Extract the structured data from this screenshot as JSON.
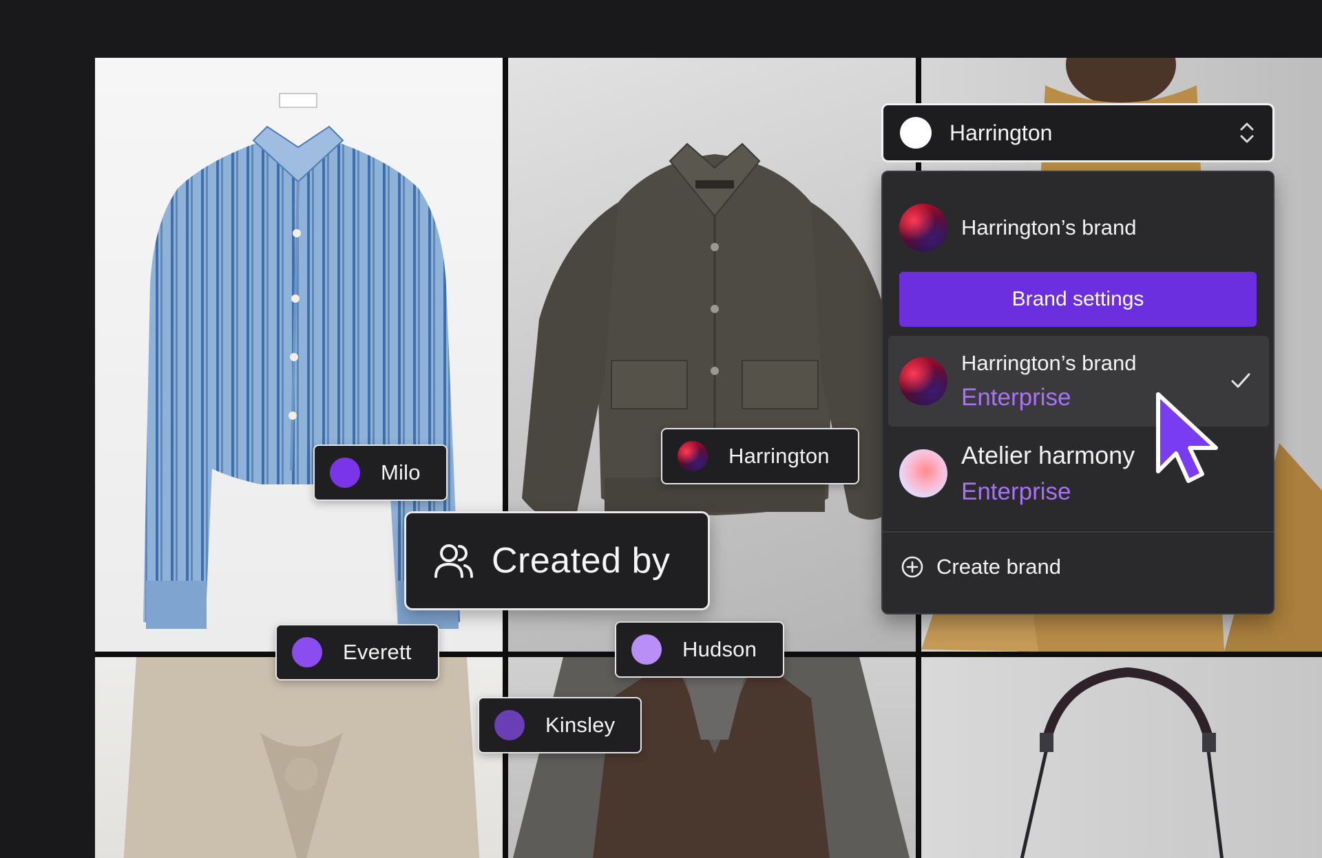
{
  "colors": {
    "accent": "#6b2fe0",
    "plan_text": "#a873f5",
    "tag_dot_milo": "#7b35e8",
    "tag_dot_everett": "#8b4df0",
    "tag_dot_hudson": "#b98ef7",
    "tag_dot_kinsley": "#6a3fb5"
  },
  "tags": {
    "milo": "Milo",
    "harrington": "Harrington",
    "everett": "Everett",
    "hudson": "Hudson",
    "kinsley": "Kinsley"
  },
  "created_by": {
    "icon": "users-icon",
    "label": "Created by"
  },
  "brand_selector": {
    "selected": "Harrington",
    "icon": "chevron-up-down-icon"
  },
  "dropdown": {
    "header_title": "Harrington’s brand",
    "settings_button": "Brand settings",
    "options": [
      {
        "name": "Harrington’s brand",
        "plan": "Enterprise",
        "selected": true
      },
      {
        "name": "Atelier harmony",
        "plan": "Enterprise",
        "selected": false
      }
    ],
    "create_label": "Create brand",
    "create_icon": "plus-circle-icon"
  }
}
